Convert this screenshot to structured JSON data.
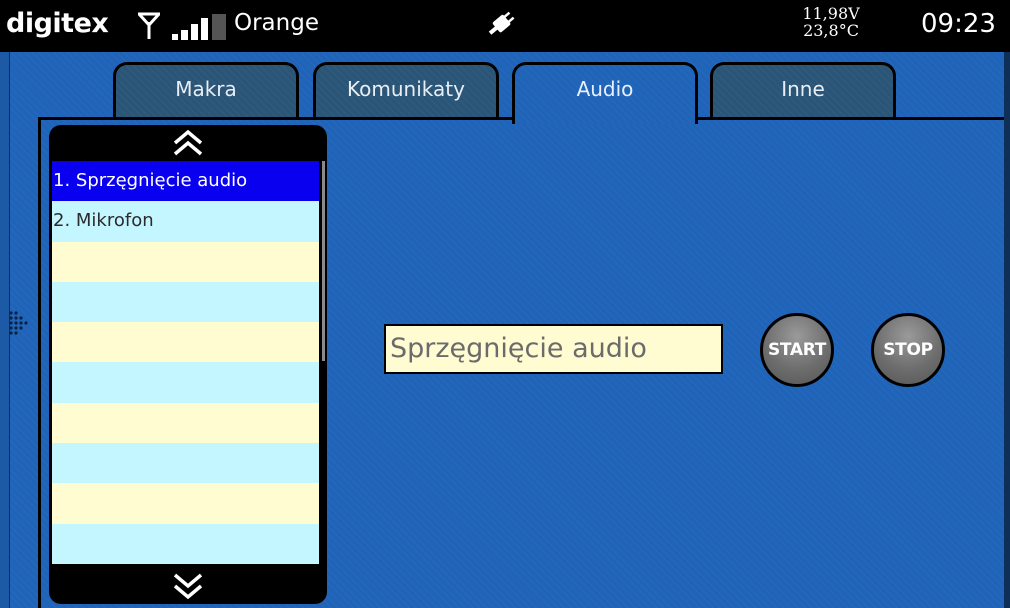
{
  "status": {
    "brand": "digitex",
    "operator": "Orange",
    "voltage": "11,98V",
    "temperature": "23,8°C",
    "time": "09:23",
    "icons": [
      "antenna-icon",
      "signal-bars-icon",
      "plug-icon"
    ]
  },
  "tabs": [
    {
      "label": "Makra"
    },
    {
      "label": "Komunikaty"
    },
    {
      "label": "Audio"
    },
    {
      "label": "Inne"
    }
  ],
  "active_tab": "Audio",
  "list": {
    "items": [
      {
        "label": "1. Sprzęgnięcie audio"
      },
      {
        "label": "2. Mikrofon"
      },
      {
        "label": ""
      },
      {
        "label": ""
      },
      {
        "label": ""
      },
      {
        "label": ""
      },
      {
        "label": ""
      },
      {
        "label": ""
      },
      {
        "label": ""
      },
      {
        "label": ""
      }
    ],
    "selected_index": 0
  },
  "selected_name": "Sprzęgnięcie audio",
  "buttons": {
    "start": "START",
    "stop": "STOP"
  },
  "colors": {
    "background": "#1f64b8",
    "selection": "#0a00f0",
    "row_odd": "#fffcd2",
    "row_even": "#c4f6ff"
  }
}
